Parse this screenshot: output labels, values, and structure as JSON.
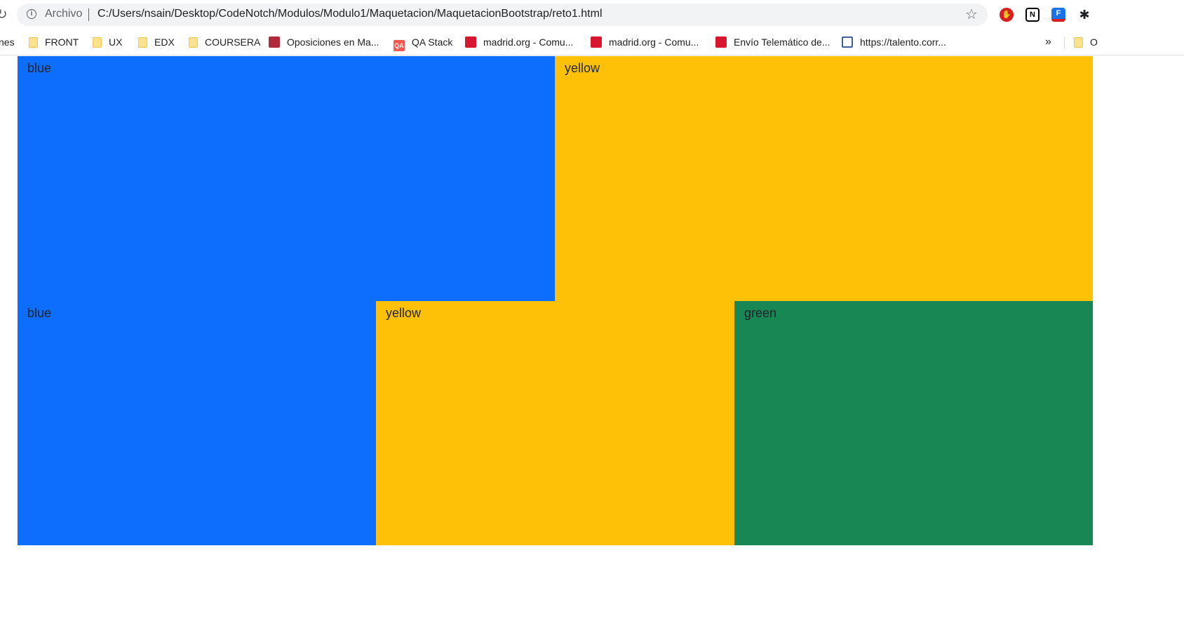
{
  "browser": {
    "scheme_label": "Archivo",
    "url": "C:/Users/nsain/Desktop/CodeNotch/Modulos/Modulo1/Maquetacion/MaquetacionBootstrap/reto1.html",
    "bookmarks_left_cut": "nes",
    "bookmarks": [
      {
        "label": "FRONT",
        "icon": "folder-icon"
      },
      {
        "label": "UX",
        "icon": "folder-icon"
      },
      {
        "label": "EDX",
        "icon": "folder-icon"
      },
      {
        "label": "COURSERA",
        "icon": "folder-icon"
      },
      {
        "label": "Oposiciones en Ma...",
        "icon": "oposiciones-favicon"
      },
      {
        "label": "QA Stack",
        "icon": "qa-favicon"
      },
      {
        "label": "madrid.org - Comu...",
        "icon": "madrid-favicon"
      },
      {
        "label": "madrid.org - Comu...",
        "icon": "madrid-favicon"
      },
      {
        "label": "Envío Telemático de...",
        "icon": "madrid-favicon"
      },
      {
        "label": "https://talento.corr...",
        "icon": "correos-favicon"
      }
    ],
    "overflow_label": "»",
    "other_bookmarks_cut": "O",
    "qa_icon_text": "QA"
  },
  "grid": {
    "row1": [
      {
        "label": "blue",
        "color": "#0d6efd"
      },
      {
        "label": "yellow",
        "color": "#ffc107"
      }
    ],
    "row2": [
      {
        "label": "blue",
        "color": "#0d6efd"
      },
      {
        "label": "yellow",
        "color": "#ffc107"
      },
      {
        "label": "green",
        "color": "#198754"
      }
    ]
  }
}
